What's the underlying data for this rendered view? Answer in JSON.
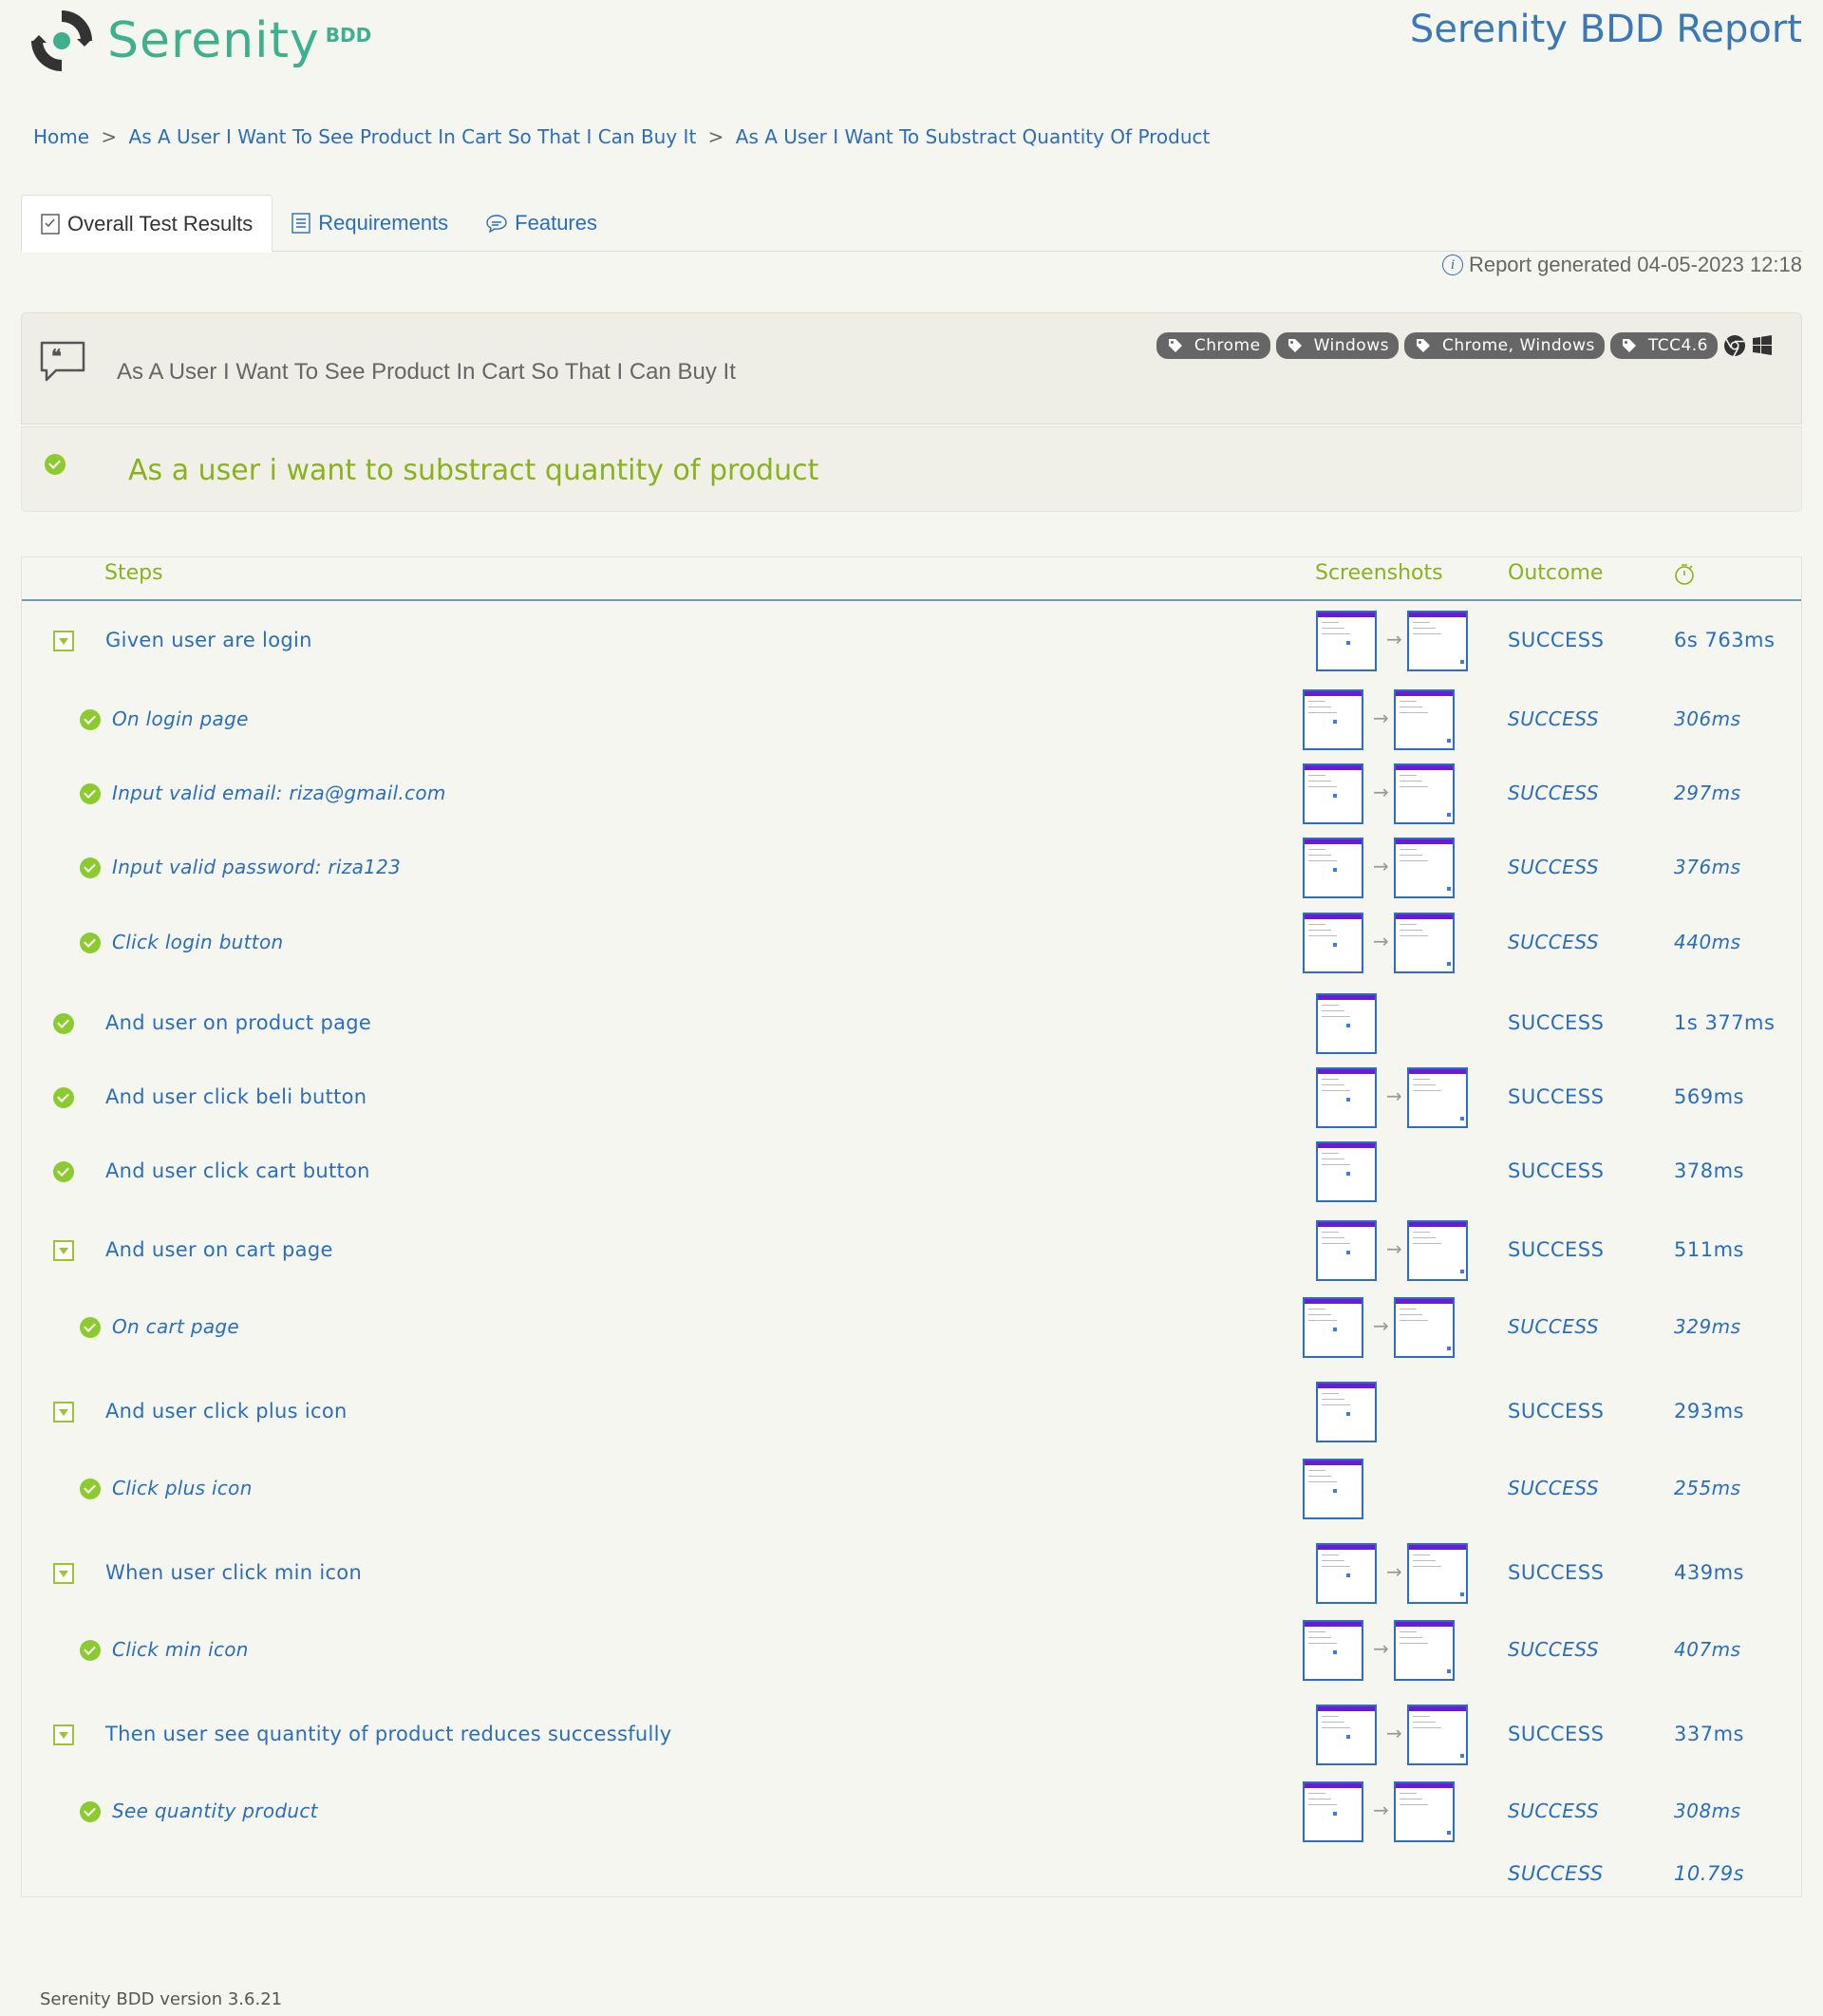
{
  "brand": {
    "name": "Serenity",
    "suffix": "BDD"
  },
  "report_title": "Serenity BDD Report",
  "breadcrumb": {
    "home": "Home",
    "separator": ">",
    "feature": "As A User I Want To See Product In Cart So That I Can Buy It",
    "scenario": "As A User I Want To Substract Quantity Of Product"
  },
  "tabs": [
    {
      "label": "Overall Test Results",
      "icon": "checklist-icon",
      "active": true
    },
    {
      "label": "Requirements",
      "icon": "document-icon",
      "active": false
    },
    {
      "label": "Features",
      "icon": "speech-bubble-icon",
      "active": false
    }
  ],
  "report_generated": "Report generated 04-05-2023 12:18",
  "feature": {
    "title": "As A User I Want To See Product In Cart So That I Can Buy It",
    "tags": [
      "Chrome",
      "Windows",
      "Chrome, Windows",
      "TCC4.6"
    ]
  },
  "scenario": {
    "title": "As a user i want to substract quantity of product",
    "status": "passed"
  },
  "table_headers": {
    "steps": "Steps",
    "screenshots": "Screenshots",
    "outcome": "Outcome",
    "duration_icon": "stopwatch-icon"
  },
  "steps": [
    {
      "label": "Given user are login",
      "outcome": "SUCCESS",
      "duration": "6s 763ms",
      "level": 0,
      "toggle": true,
      "screenshots": 2
    },
    {
      "label": "On login page",
      "outcome": "SUCCESS",
      "duration": "306ms",
      "level": 1,
      "toggle": false,
      "screenshots": 2
    },
    {
      "label": "Input valid email: riza@gmail.com",
      "outcome": "SUCCESS",
      "duration": "297ms",
      "level": 1,
      "toggle": false,
      "screenshots": 2
    },
    {
      "label": "Input valid password: riza123",
      "outcome": "SUCCESS",
      "duration": "376ms",
      "level": 1,
      "toggle": false,
      "screenshots": 2
    },
    {
      "label": "Click login button",
      "outcome": "SUCCESS",
      "duration": "440ms",
      "level": 1,
      "toggle": false,
      "screenshots": 2
    },
    {
      "label": "And user on product page",
      "outcome": "SUCCESS",
      "duration": "1s 377ms",
      "level": 0,
      "toggle": false,
      "screenshots": 1
    },
    {
      "label": "And user click beli button",
      "outcome": "SUCCESS",
      "duration": "569ms",
      "level": 0,
      "toggle": false,
      "screenshots": 2
    },
    {
      "label": "And user click cart button",
      "outcome": "SUCCESS",
      "duration": "378ms",
      "level": 0,
      "toggle": false,
      "screenshots": 1
    },
    {
      "label": "And user on cart page",
      "outcome": "SUCCESS",
      "duration": "511ms",
      "level": 0,
      "toggle": true,
      "screenshots": 2
    },
    {
      "label": "On cart page",
      "outcome": "SUCCESS",
      "duration": "329ms",
      "level": 1,
      "toggle": false,
      "screenshots": 2
    },
    {
      "label": "And user click plus icon",
      "outcome": "SUCCESS",
      "duration": "293ms",
      "level": 0,
      "toggle": true,
      "screenshots": 1
    },
    {
      "label": "Click plus icon",
      "outcome": "SUCCESS",
      "duration": "255ms",
      "level": 1,
      "toggle": false,
      "screenshots": 1
    },
    {
      "label": "When user click min icon",
      "outcome": "SUCCESS",
      "duration": "439ms",
      "level": 0,
      "toggle": true,
      "screenshots": 2
    },
    {
      "label": "Click min icon",
      "outcome": "SUCCESS",
      "duration": "407ms",
      "level": 1,
      "toggle": false,
      "screenshots": 2
    },
    {
      "label": "Then user see quantity of product reduces successfully",
      "outcome": "SUCCESS",
      "duration": "337ms",
      "level": 0,
      "toggle": true,
      "screenshots": 2
    },
    {
      "label": "See quantity product",
      "outcome": "SUCCESS",
      "duration": "308ms",
      "level": 1,
      "toggle": false,
      "screenshots": 2
    }
  ],
  "total": {
    "outcome": "SUCCESS",
    "duration": "10.79s"
  },
  "footer": "Serenity BDD version 3.6.21",
  "colors": {
    "accent_green": "#8ab21d",
    "link_blue": "#2a6ebb",
    "title_blue": "#3a78b8",
    "tag_gray": "#666666",
    "brand_green": "#3fb08d"
  }
}
